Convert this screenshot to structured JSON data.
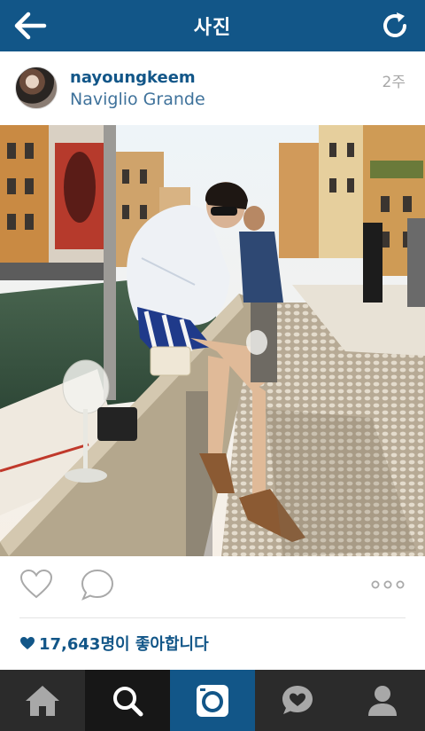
{
  "header": {
    "title": "사진",
    "back_icon": "arrow-left-icon",
    "refresh_icon": "refresh-icon"
  },
  "post": {
    "username": "nayoungkeem",
    "location": "Naviglio Grande",
    "time_ago": "2주",
    "likes_text": "17,643명이 좋아합니다"
  },
  "actions": {
    "like_icon": "heart-outline-icon",
    "comment_icon": "comment-bubble-icon",
    "more_icon": "ellipsis-icon"
  },
  "tabs": [
    {
      "name": "home",
      "icon": "home-icon"
    },
    {
      "name": "search",
      "icon": "search-icon"
    },
    {
      "name": "camera",
      "icon": "camera-icon",
      "active": true
    },
    {
      "name": "activity",
      "icon": "activity-heart-bubble-icon"
    },
    {
      "name": "profile",
      "icon": "profile-icon"
    }
  ],
  "colors": {
    "brand_blue": "#125688",
    "link_blue": "#3f729b",
    "tabbar": "#2b2b2b",
    "tab_search": "#171717"
  }
}
